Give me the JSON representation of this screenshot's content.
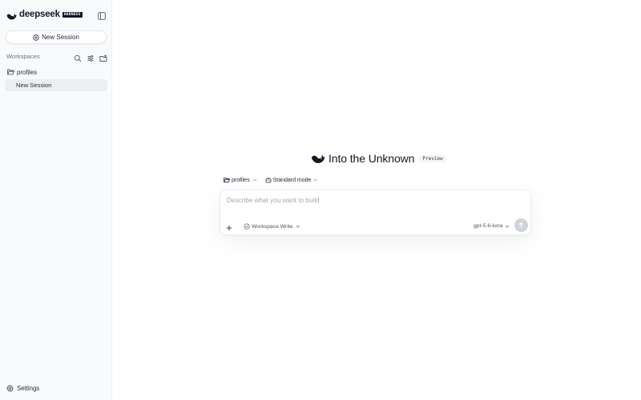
{
  "brand": {
    "name": "deepseek",
    "badge": "HARNESS"
  },
  "sidebar": {
    "new_session_label": "New Session",
    "workspaces_title": "Workspaces",
    "workspace_actions": [
      "search-icon",
      "filter-icon",
      "add-folder-icon"
    ],
    "workspaces": [
      {
        "name": "profiles",
        "sessions": [
          {
            "label": "New Session",
            "active": true
          }
        ]
      }
    ],
    "settings_label": "Settings"
  },
  "main": {
    "hero_title": "Into the Unknown",
    "hero_badge": "Preview",
    "workspace_selector": "profiles",
    "mode_selector": "Standard mode",
    "composer": {
      "placeholder": "Describe what you want to build",
      "value": "",
      "permission_mode": "Workspace Write",
      "model": "gpt-5.6-luna"
    }
  },
  "colors": {
    "sidebar_bg": "#f9fafb",
    "active_item_bg": "#eceef1",
    "send_button_disabled": "#cfd3da",
    "text_primary": "#111827",
    "text_muted": "#6b7280"
  }
}
